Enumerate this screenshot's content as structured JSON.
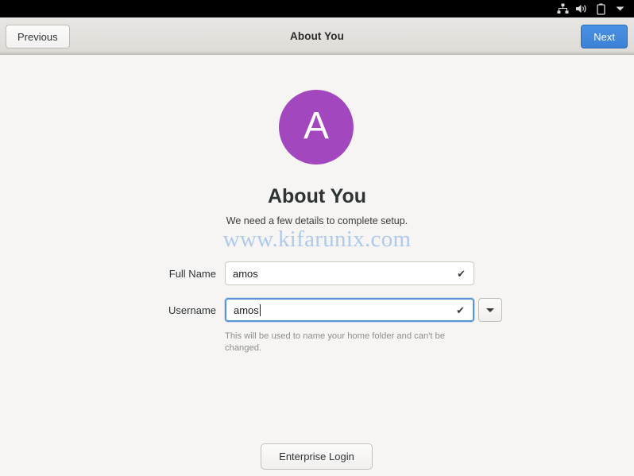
{
  "topbar": {
    "icons": [
      {
        "name": "network-wired-icon",
        "label": "Network"
      },
      {
        "name": "volume-icon",
        "label": "Volume"
      },
      {
        "name": "battery-icon",
        "label": "Battery"
      },
      {
        "name": "chevron-down-icon",
        "label": "System menu"
      }
    ]
  },
  "headerbar": {
    "previous_label": "Previous",
    "title": "About You",
    "next_label": "Next",
    "next_color": "#3b82d6"
  },
  "main": {
    "avatar_letter": "A",
    "avatar_color": "#a347bf",
    "title": "About You",
    "subtitle": "We need a few details to complete setup.",
    "watermark": "www.kifarunix.com",
    "watermark_color": "#9ec1e8"
  },
  "form": {
    "fields": [
      {
        "label": "Full Name",
        "value": "amos",
        "placeholder": "",
        "valid_icon": "✔",
        "focused": false,
        "has_dropdown": false
      },
      {
        "label": "Username",
        "value": "amos",
        "placeholder": "",
        "valid_icon": "✔",
        "focused": true,
        "has_dropdown": true
      }
    ],
    "help_text": "This will be used to name your home folder and can't be changed."
  },
  "footer": {
    "enterprise_login_label": "Enterprise Login"
  }
}
